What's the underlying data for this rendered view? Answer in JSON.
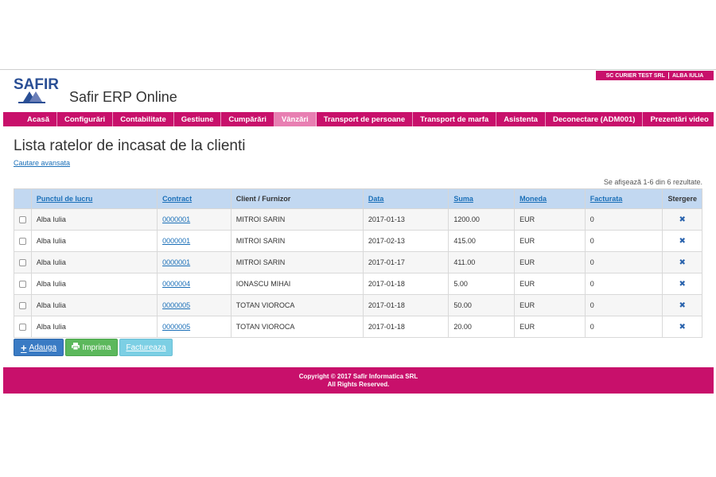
{
  "company": {
    "name": "SC CURIER TEST SRL",
    "location": "ALBA IULIA"
  },
  "logo": {
    "text": "SAFIR"
  },
  "app": {
    "title": "Safir ERP Online"
  },
  "nav": {
    "items": [
      {
        "label": "Acasă"
      },
      {
        "label": "Configurări"
      },
      {
        "label": "Contabilitate"
      },
      {
        "label": "Gestiune"
      },
      {
        "label": "Cumpărări"
      },
      {
        "label": "Vânzări"
      },
      {
        "label": "Transport de persoane"
      },
      {
        "label": "Transport de marfa"
      },
      {
        "label": "Asistenta"
      },
      {
        "label": "Deconectare (ADM001)"
      },
      {
        "label": "Prezentări video"
      }
    ],
    "active_index": 5
  },
  "page": {
    "title": "Lista ratelor de incasat de la clienti",
    "advanced_search": "Cautare avansata",
    "summary": "Se afişează 1-6 din 6 rezultate."
  },
  "table": {
    "headers": {
      "location": "Punctul de lucru",
      "contract": "Contract",
      "client": "Client / Furnizor",
      "date": "Data",
      "amount": "Suma",
      "currency": "Moneda",
      "invoiced": "Facturata",
      "delete": "Stergere"
    },
    "rows": [
      {
        "location": "Alba Iulia",
        "contract": "0000001",
        "client": "MITROI SARIN",
        "date": "2017-01-13",
        "amount": "1200.00",
        "currency": "EUR",
        "invoiced": "0"
      },
      {
        "location": "Alba Iulia",
        "contract": "0000001",
        "client": "MITROI SARIN",
        "date": "2017-02-13",
        "amount": "415.00",
        "currency": "EUR",
        "invoiced": "0"
      },
      {
        "location": "Alba Iulia",
        "contract": "0000001",
        "client": "MITROI SARIN",
        "date": "2017-01-17",
        "amount": "411.00",
        "currency": "EUR",
        "invoiced": "0"
      },
      {
        "location": "Alba Iulia",
        "contract": "0000004",
        "client": "IONASCU MIHAI",
        "date": "2017-01-18",
        "amount": "5.00",
        "currency": "EUR",
        "invoiced": "0"
      },
      {
        "location": "Alba Iulia",
        "contract": "0000005",
        "client": "TOTAN VIOROCA",
        "date": "2017-01-18",
        "amount": "50.00",
        "currency": "EUR",
        "invoiced": "0"
      },
      {
        "location": "Alba Iulia",
        "contract": "0000005",
        "client": "TOTAN VIOROCA",
        "date": "2017-01-18",
        "amount": "20.00",
        "currency": "EUR",
        "invoiced": "0"
      }
    ]
  },
  "buttons": {
    "add": "Adauga",
    "print": "Imprima",
    "invoice": "Factureaza"
  },
  "footer": {
    "line1": "Copyright © 2017 Safir Informatica SRL",
    "line2": "All Rights Reserved."
  },
  "colors": {
    "brand": "#c8106b",
    "nav_active": "#e87fb2",
    "header_bg": "#c2d8f1",
    "link": "#1a6fb8"
  }
}
